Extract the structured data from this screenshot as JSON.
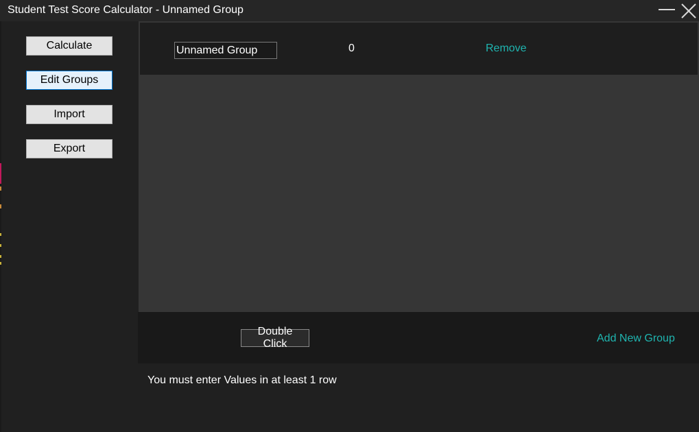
{
  "window": {
    "title": "Student Test Score Calculator - Unnamed Group"
  },
  "sidebar": {
    "items": [
      {
        "label": "Calculate",
        "active": false
      },
      {
        "label": "Edit Groups",
        "active": true
      },
      {
        "label": "Import",
        "active": false
      },
      {
        "label": "Export",
        "active": false
      }
    ]
  },
  "groups": [
    {
      "name": "Unnamed Group",
      "count": "0",
      "remove_label": "Remove"
    }
  ],
  "footer": {
    "double_click_label": "Double Click",
    "add_group_label": "Add New Group"
  },
  "status": {
    "message": "You must enter Values in at least 1 row"
  },
  "colors": {
    "background": "#202020",
    "panel": "#363636",
    "row": "#1e1e1e",
    "link": "#1fb5b0",
    "active_button": "#e5f1fb",
    "active_border": "#0078d7"
  }
}
